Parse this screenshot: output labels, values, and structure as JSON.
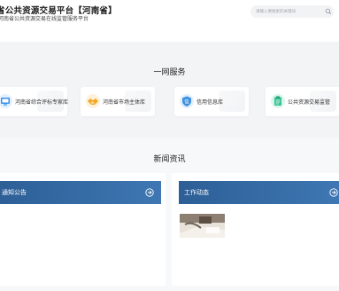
{
  "header": {
    "title": "省公共资源交易平台【河南省】",
    "subtitle": "河南省公共资源交易在线监管服务平台",
    "search_placeholder": "请输入要搜索的关键词"
  },
  "services": {
    "title": "一网服务",
    "items": [
      {
        "label": "河南省综合评标专家库",
        "icon": "expert-screen-icon",
        "color": "#3b8ee8"
      },
      {
        "label": "河南省市场主体库",
        "icon": "handshake-icon",
        "color": "#f5a623"
      },
      {
        "label": "信用信息库",
        "icon": "credit-shield-icon",
        "color": "#3d8fe0"
      },
      {
        "label": "公共资源交易监管",
        "icon": "supervision-icon",
        "color": "#2fbf8f"
      }
    ]
  },
  "news": {
    "title": "新闻资讯",
    "panels": [
      {
        "title": "通知公告"
      },
      {
        "title": "工作动态"
      }
    ]
  },
  "colors": {
    "panel_header": "#2d5f96",
    "page_bg": "#f3f4f6"
  }
}
